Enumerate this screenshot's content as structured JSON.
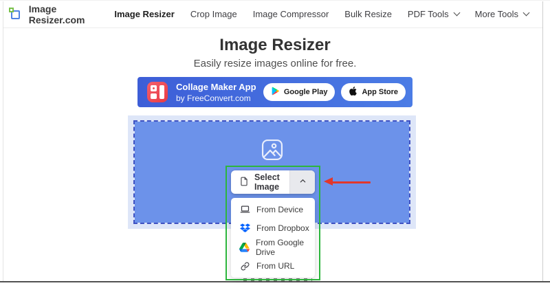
{
  "header": {
    "logo_text": "Image Resizer.com",
    "nav_items": [
      {
        "label": "Image Resizer",
        "active": true,
        "has_dropdown": false
      },
      {
        "label": "Crop Image",
        "active": false,
        "has_dropdown": false
      },
      {
        "label": "Image Compressor",
        "active": false,
        "has_dropdown": false
      },
      {
        "label": "Bulk Resize",
        "active": false,
        "has_dropdown": false
      },
      {
        "label": "PDF Tools",
        "active": false,
        "has_dropdown": true
      },
      {
        "label": "More Tools",
        "active": false,
        "has_dropdown": true
      }
    ]
  },
  "hero": {
    "title": "Image Resizer",
    "subtitle": "Easily resize images online for free."
  },
  "promo_banner": {
    "app_name": "Collage Maker App",
    "byline": "by FreeConvert.com",
    "buttons": [
      {
        "label": "Google Play",
        "icon": "google-play-icon"
      },
      {
        "label": "App Store",
        "icon": "apple-icon"
      }
    ]
  },
  "uploader": {
    "select_button": {
      "label": "Select Image",
      "icon": "file-icon",
      "caret_icon": "chevron-up-icon"
    },
    "menu_items": [
      {
        "label": "From Device",
        "icon": "device-icon"
      },
      {
        "label": "From Dropbox",
        "icon": "dropbox-icon"
      },
      {
        "label": "From Google Drive",
        "icon": "google-drive-icon"
      },
      {
        "label": "From URL",
        "icon": "link-icon"
      }
    ]
  },
  "annotations": {
    "highlight_box_color": "#2cb53c",
    "arrow_color": "#e2372b"
  },
  "colors": {
    "banner_blue_start": "#3d5ed7",
    "banner_blue_end": "#4b7ce5",
    "dropzone_fill": "#6c92ea",
    "dropzone_outer": "#dee6f8",
    "dropzone_dash": "#3f52c2",
    "dropbox_blue": "#0062ff",
    "logo_blue": "#4f83e3",
    "logo_green": "#79c14a"
  }
}
